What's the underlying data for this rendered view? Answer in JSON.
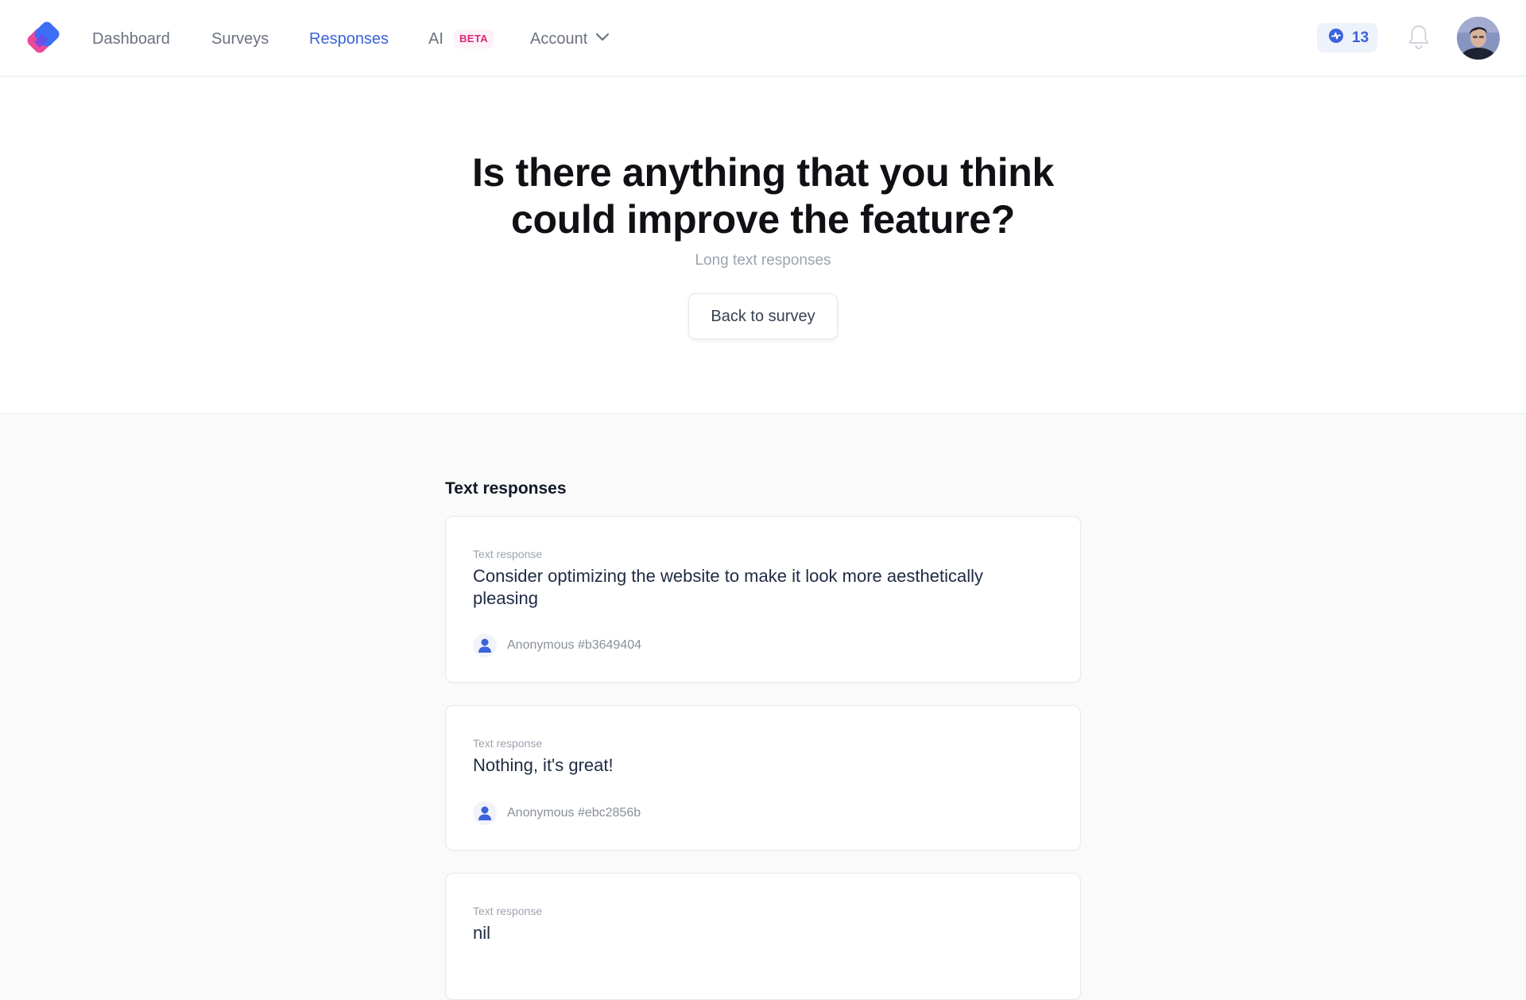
{
  "nav": {
    "links": [
      {
        "label": "Dashboard"
      },
      {
        "label": "Surveys"
      },
      {
        "label": "Responses"
      },
      {
        "label": "AI"
      }
    ],
    "beta_badge": "BETA",
    "account_label": "Account",
    "credits_count": "13",
    "icons": [
      "app-logo",
      "chevron-down-icon",
      "sparkle-credit-icon",
      "bell-icon",
      "avatar"
    ],
    "colors": {
      "active": "#3b63dc",
      "beta": "#db2777",
      "logo_blue": "#3b6ef5",
      "logo_pink": "#ec4899"
    }
  },
  "hero": {
    "question": "Is there anything that you think could improve the feature?",
    "subtitle": "Long text responses",
    "back_button": "Back to survey"
  },
  "responses": {
    "section_title": "Text responses",
    "items": [
      {
        "label": "Text response",
        "text": "Consider optimizing the website to make it look more aesthetically pleasing",
        "responder": "Anonymous #b3649404"
      },
      {
        "label": "Text response",
        "text": "Nothing, it's great!",
        "responder": "Anonymous #ebc2856b"
      },
      {
        "label": "Text response",
        "text": "nil"
      }
    ]
  }
}
